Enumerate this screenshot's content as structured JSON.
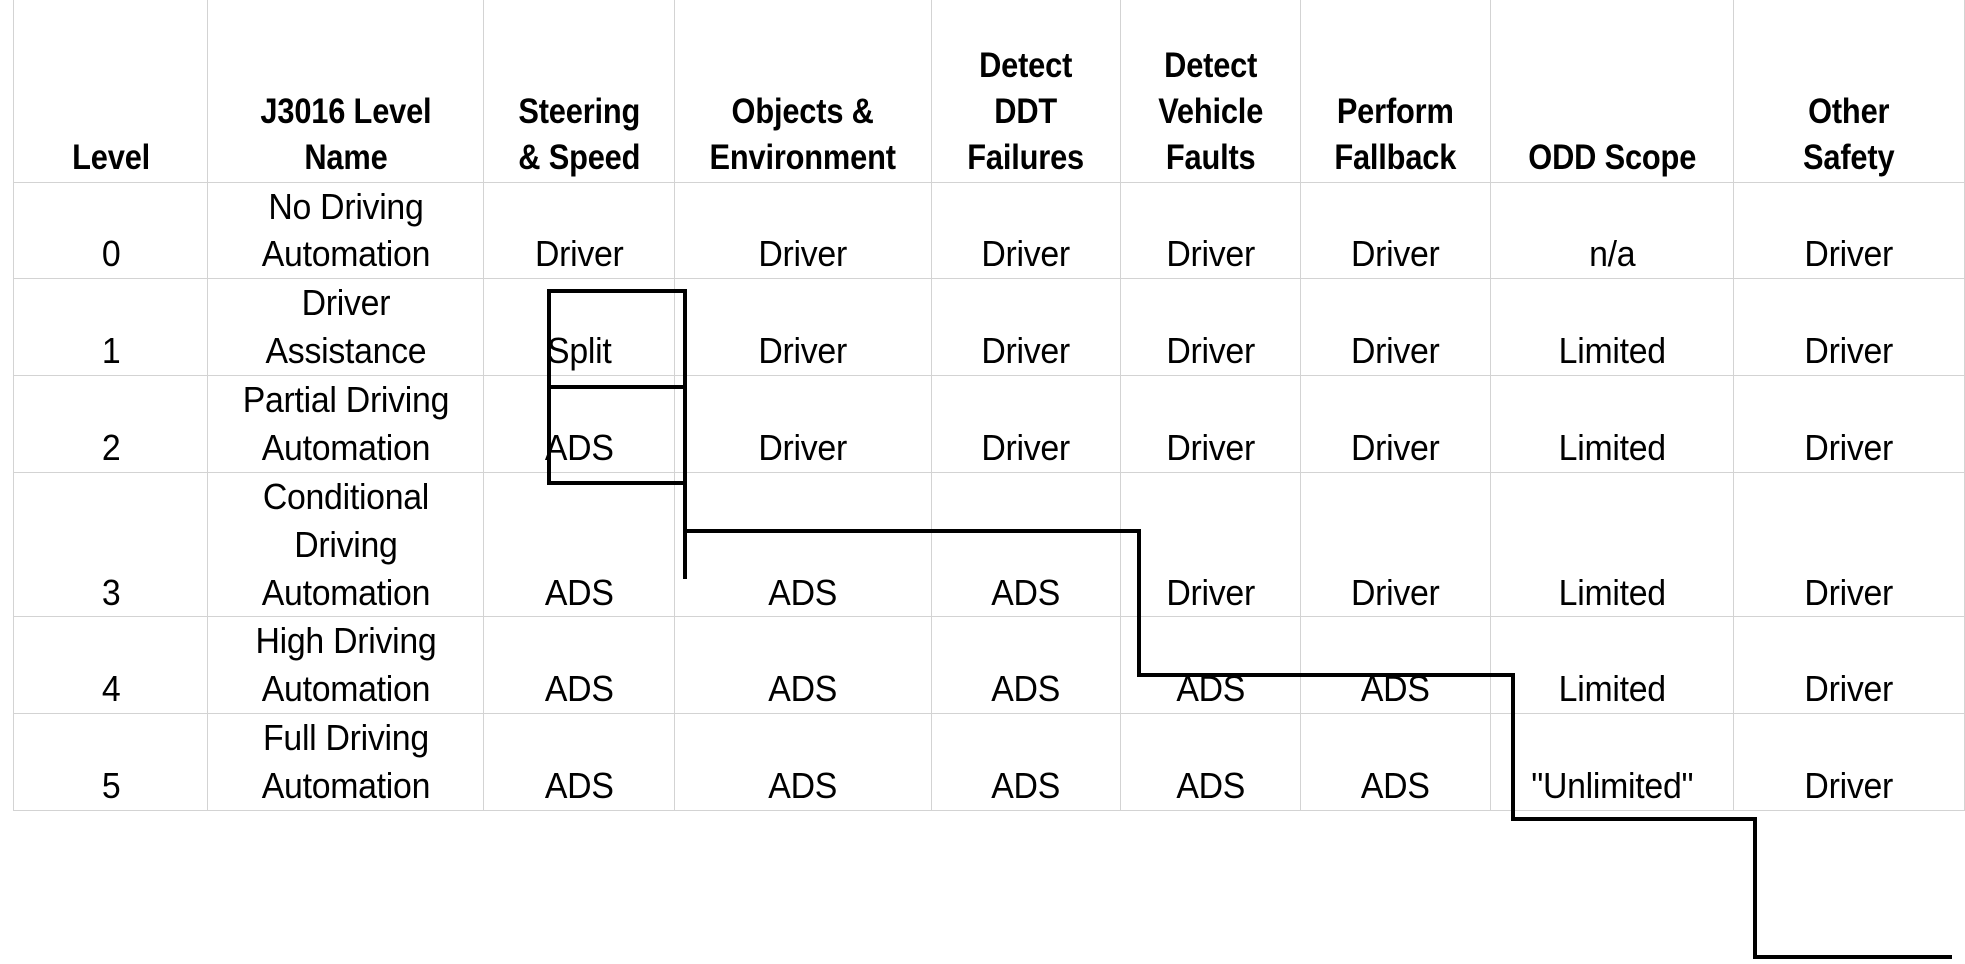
{
  "table": {
    "columns": [
      {
        "key": "level",
        "lines": [
          "Level"
        ]
      },
      {
        "key": "name",
        "lines": [
          "J3016 Level",
          "Name"
        ]
      },
      {
        "key": "steering",
        "lines": [
          "Steering",
          "& Speed"
        ]
      },
      {
        "key": "objects",
        "lines": [
          "Objects &",
          "Environment"
        ]
      },
      {
        "key": "ddt",
        "lines": [
          "Detect",
          "DDT",
          "Failures"
        ]
      },
      {
        "key": "faults",
        "lines": [
          "Detect",
          "Vehicle",
          "Faults"
        ]
      },
      {
        "key": "fallback",
        "lines": [
          "Perform",
          "Fallback"
        ]
      },
      {
        "key": "odd",
        "lines": [
          "ODD Scope"
        ]
      },
      {
        "key": "other",
        "lines": [
          "Other",
          "Safety"
        ]
      }
    ],
    "rows": [
      {
        "level": "0",
        "name_lines": [
          "No Driving",
          "Automation"
        ],
        "steering": "Driver",
        "objects": "Driver",
        "ddt": "Driver",
        "faults": "Driver",
        "fallback": "Driver",
        "odd": "n/a",
        "other": "Driver"
      },
      {
        "level": "1",
        "name_lines": [
          "Driver",
          "Assistance"
        ],
        "steering": "Split",
        "objects": "Driver",
        "ddt": "Driver",
        "faults": "Driver",
        "fallback": "Driver",
        "odd": "Limited",
        "other": "Driver"
      },
      {
        "level": "2",
        "name_lines": [
          "Partial Driving",
          "Automation"
        ],
        "steering": "ADS",
        "objects": "Driver",
        "ddt": "Driver",
        "faults": "Driver",
        "fallback": "Driver",
        "odd": "Limited",
        "other": "Driver"
      },
      {
        "level": "3",
        "name_lines": [
          "Conditional",
          "Driving",
          "Automation"
        ],
        "steering": "ADS",
        "objects": "ADS",
        "ddt": "ADS",
        "faults": "Driver",
        "fallback": "Driver",
        "odd": "Limited",
        "other": "Driver"
      },
      {
        "level": "4",
        "name_lines": [
          "High Driving",
          "Automation"
        ],
        "steering": "ADS",
        "objects": "ADS",
        "ddt": "ADS",
        "faults": "ADS",
        "fallback": "ADS",
        "odd": "Limited",
        "other": "Driver"
      },
      {
        "level": "5",
        "name_lines": [
          "Full Driving",
          "Automation"
        ],
        "steering": "ADS",
        "objects": "ADS",
        "ddt": "ADS",
        "faults": "ADS",
        "fallback": "ADS",
        "odd": "\"Unlimited\"",
        "other": "Driver"
      }
    ]
  },
  "style": {
    "header_rule_color": "#000000",
    "gridline_color": "#d3d3d3",
    "staircase_color": "#000000",
    "background": "#ffffff",
    "text_color": "#000000"
  }
}
